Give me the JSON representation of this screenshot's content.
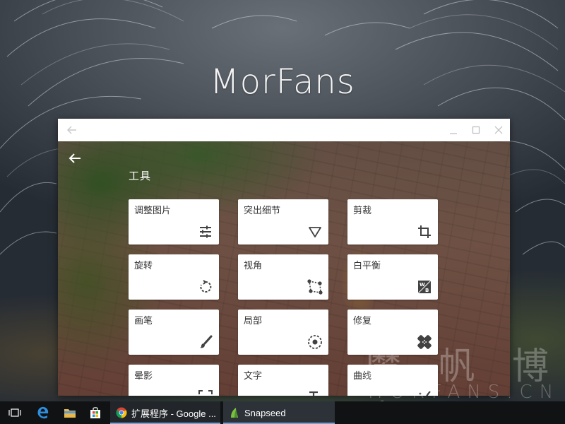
{
  "desktop": {
    "brand_title": "MorFans",
    "watermark_cn": "魔 帆 博 客",
    "watermark_en": "MORFANS.CN"
  },
  "window": {
    "back_icon": "arrow-left-icon",
    "controls": [
      "minimize-icon",
      "maximize-icon",
      "close-icon"
    ]
  },
  "app": {
    "back_icon": "arrow-left-icon",
    "section_title": "工具",
    "tools": [
      {
        "label": "调整图片",
        "icon": "tune-sliders-icon"
      },
      {
        "label": "突出细节",
        "icon": "triangle-down-icon"
      },
      {
        "label": "剪裁",
        "icon": "crop-icon"
      },
      {
        "label": "旋转",
        "icon": "rotate-icon"
      },
      {
        "label": "视角",
        "icon": "perspective-icon"
      },
      {
        "label": "白平衡",
        "icon": "white-balance-icon"
      },
      {
        "label": "画笔",
        "icon": "brush-icon"
      },
      {
        "label": "局部",
        "icon": "selective-icon"
      },
      {
        "label": "修复",
        "icon": "healing-bandage-icon"
      },
      {
        "label": "晕影",
        "icon": "vignette-icon"
      },
      {
        "label": "文字",
        "icon": "text-icon"
      },
      {
        "label": "曲线",
        "icon": "curves-icon"
      }
    ]
  },
  "taskbar": {
    "icons": [
      "task-view-icon",
      "edge-icon",
      "file-explorer-icon",
      "store-icon"
    ],
    "items": [
      {
        "label": "扩展程序 - Google ...",
        "icon": "chrome-icon"
      },
      {
        "label": "Snapseed",
        "icon": "snapseed-icon"
      }
    ]
  },
  "colors": {
    "taskbar": "#101214",
    "card": "#ffffff",
    "icon": "#424242",
    "accent_underline": "#7aa0d0"
  }
}
